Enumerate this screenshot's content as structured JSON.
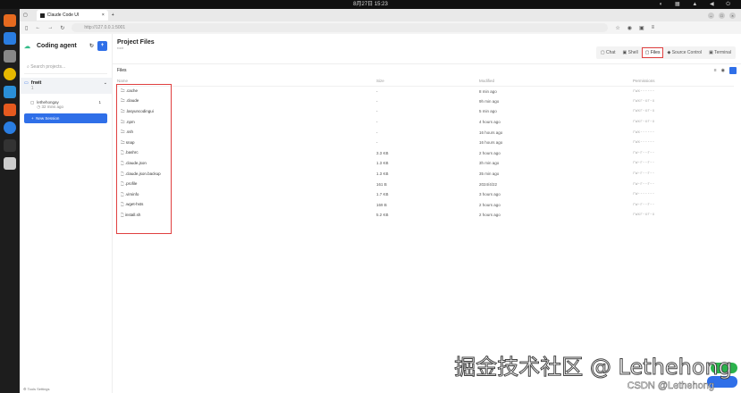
{
  "topbar": {
    "datetime": "8月27日 15:23"
  },
  "browser": {
    "tab_title": "Claude Code UI",
    "url": "http://127.0.0.1:5001"
  },
  "sidebar": {
    "app_name": "Coding agent",
    "search_placeholder": "Search projects...",
    "project": {
      "name": "frwit",
      "sub": "1"
    },
    "session": {
      "name": "lethehongay",
      "time": "32 mins ago",
      "count": "1"
    },
    "new_session": "New Session",
    "tools_settings": "Tools Settings"
  },
  "main": {
    "title": "Project Files",
    "subtitle": "root",
    "tabs": [
      "Chat",
      "Shell",
      "Files",
      "Source Control",
      "Terminal"
    ],
    "active_tab": "Files",
    "files_label": "Files",
    "columns": [
      "Name",
      "Size",
      "Modified",
      "Permissions"
    ],
    "rows": [
      {
        "type": "folder",
        "name": ".cache",
        "size": "-",
        "modified": "8 min ago",
        "perm": "rwx------"
      },
      {
        "type": "folder",
        "name": ".claude",
        "size": "-",
        "modified": "9h min ago",
        "perm": "rwxr-xr-x"
      },
      {
        "type": "folder",
        "name": ".lasyuncodingui",
        "size": "-",
        "modified": "5 min ago",
        "perm": "rwxr-xr-x"
      },
      {
        "type": "folder",
        "name": ".npm",
        "size": "-",
        "modified": "4 hours ago",
        "perm": "rwxr-xr-x"
      },
      {
        "type": "folder",
        "name": ".ssh",
        "size": "-",
        "modified": "16 hours ago",
        "perm": "rwx------"
      },
      {
        "type": "folder",
        "name": "snap",
        "size": "-",
        "modified": "16 hours ago",
        "perm": "rwx------"
      },
      {
        "type": "file",
        "name": ".bashrc",
        "size": "3.3 KB",
        "modified": "2 hours ago",
        "perm": "rw-r--r--"
      },
      {
        "type": "file",
        "name": ".claude.json",
        "size": "1.3 KB",
        "modified": "3h min ago",
        "perm": "rw-r--r--"
      },
      {
        "type": "file",
        "name": ".claude.json.backup",
        "size": "1.3 KB",
        "modified": "35 min ago",
        "perm": "rw-r--r--"
      },
      {
        "type": "file",
        "name": ".profile",
        "size": "161 B",
        "modified": "2024/4/22",
        "perm": "rw-r--r--"
      },
      {
        "type": "file",
        "name": ".viminfo",
        "size": "1.7 KB",
        "modified": "3 hours ago",
        "perm": "rw-------"
      },
      {
        "type": "file",
        "name": ".wget-hsts",
        "size": "169 B",
        "modified": "2 hours ago",
        "perm": "rw-r--r--"
      },
      {
        "type": "file",
        "name": "install.sh",
        "size": "5.2 KB",
        "modified": "2 hours ago",
        "perm": "rwxr-xr-x"
      }
    ]
  },
  "watermark": {
    "main": "掘金技术社区 @ Lethehong",
    "csdn": "CSDN @Lethehong"
  }
}
